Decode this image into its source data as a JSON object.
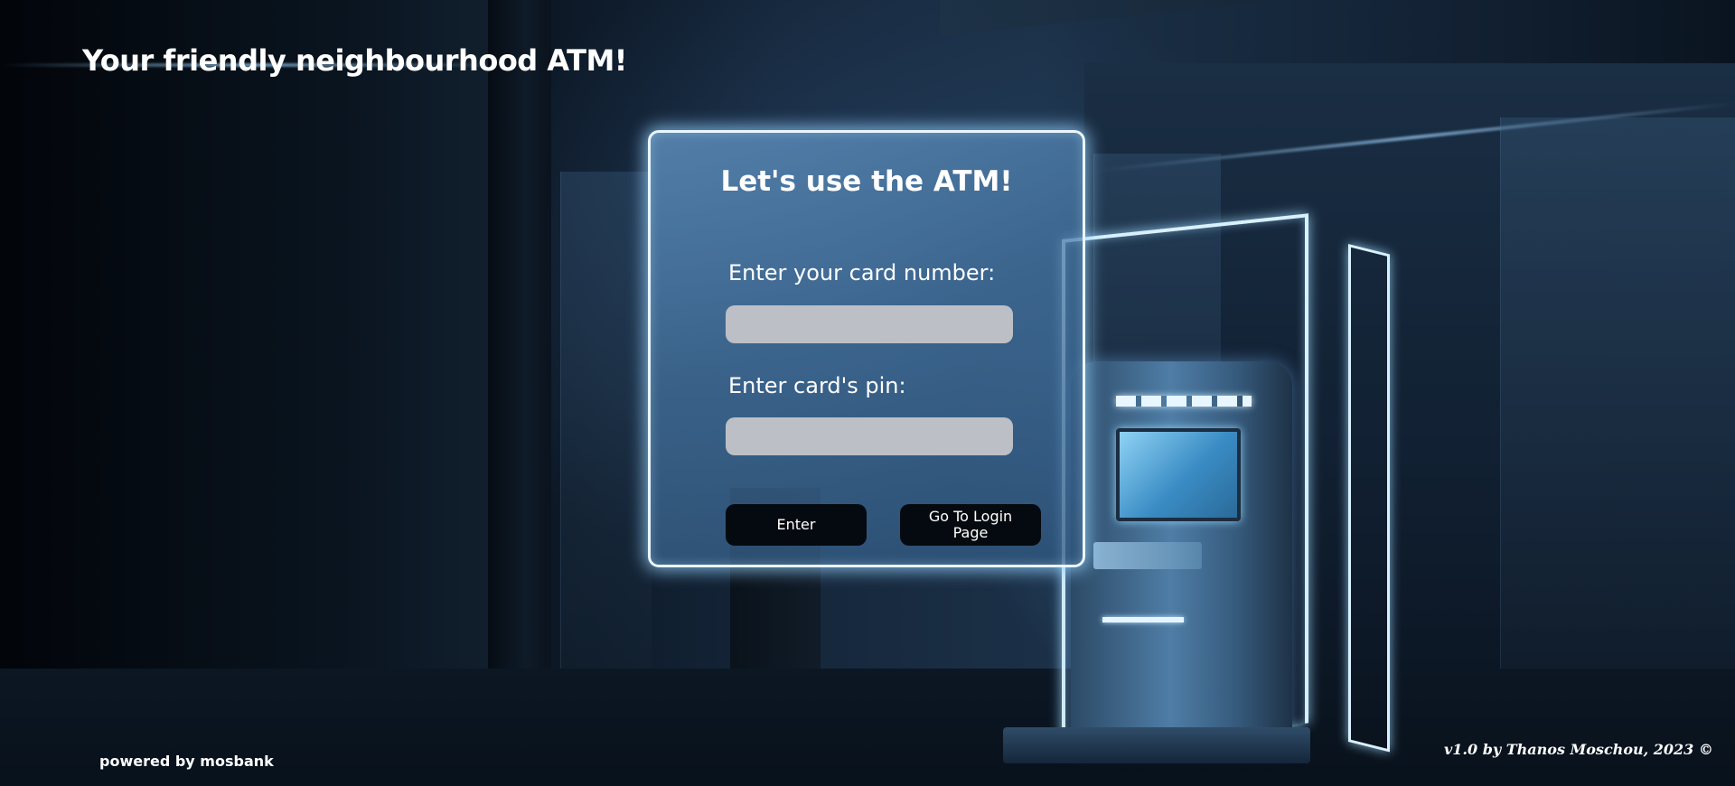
{
  "header": {
    "title": "Your friendly neighbourhood ATM!"
  },
  "card": {
    "title": "Let's use the ATM!",
    "card_number_label": "Enter your card number:",
    "card_number_value": "",
    "pin_label": "Enter card's pin:",
    "pin_value": "",
    "enter_button_label": "Enter",
    "login_button_label": "Go To Login Page"
  },
  "footer": {
    "powered_by": "powered by mosbank",
    "version_credit": "v1.0 by Thanos Moschou, 2023 ©"
  },
  "colors": {
    "card_border": "#e9f6ff",
    "input_background": "#bcc0c6",
    "button_background": "#050a10",
    "text": "#ffffff"
  }
}
